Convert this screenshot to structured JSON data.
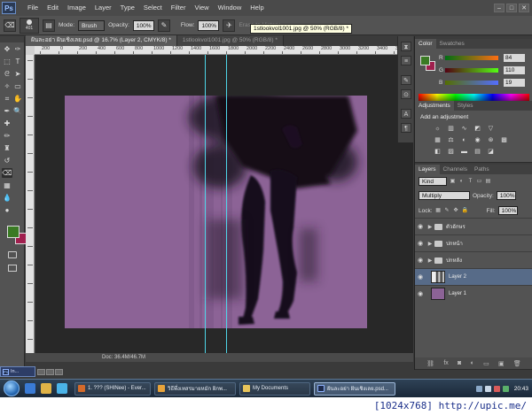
{
  "app": {
    "logo": "Ps",
    "menus": [
      "File",
      "Edit",
      "Image",
      "Layer",
      "Type",
      "Select",
      "Filter",
      "View",
      "Window",
      "Help"
    ],
    "window_controls": [
      "–",
      "□",
      "✕"
    ]
  },
  "options_bar": {
    "brush_size": "401",
    "mode_label": "Mode:",
    "mode_value": "Brush",
    "opacity_label": "Opacity:",
    "opacity_value": "100%",
    "flow_label": "Flow:",
    "flow_value": "100%",
    "erase_to_history": "Erase to History"
  },
  "tooltip": "1stlookvol1001.jpg @ 50% (RGB/8) *",
  "document_tabs": [
    {
      "label": "ฝันละอย่า ฝันเชิงเลย.psd @ 16.7% (Layer 2, CMYK/8) *",
      "active": true
    },
    {
      "label": "1stlookvol1001.jpg @ 50% (RGB/8) *",
      "active": false
    }
  ],
  "ruler": {
    "h_labels": [
      "200",
      "0",
      "200",
      "400",
      "600",
      "800",
      "1000",
      "1200",
      "1400",
      "1600",
      "1800",
      "2000",
      "2200",
      "2400",
      "2600",
      "2800",
      "3000",
      "3200",
      "3400",
      "3600"
    ]
  },
  "status_bar": "Doc: 36.4M/46.7M",
  "minimized_doc": "In...",
  "color_panel": {
    "tabs": [
      "Color",
      "Swatches"
    ],
    "fg": "#3a7a24",
    "bg": "#a01f4e",
    "channels": [
      {
        "name": "R",
        "value": "84"
      },
      {
        "name": "G",
        "value": "110"
      },
      {
        "name": "B",
        "value": "19"
      }
    ]
  },
  "adjustments_panel": {
    "tabs": [
      "Adjustments",
      "Styles"
    ],
    "title": "Add an adjustment"
  },
  "layers_panel": {
    "tabs": [
      "Layers",
      "Channels",
      "Paths"
    ],
    "filter_kind": "Kind",
    "blend_mode": "Multiply",
    "opacity_label": "Opacity:",
    "opacity_value": "100%",
    "lock_label": "Lock:",
    "fill_label": "Fill:",
    "fill_value": "100%",
    "layers": [
      {
        "name": "ตัวอักษร",
        "type": "group",
        "selected": false
      },
      {
        "name": "ปกหน้า",
        "type": "group",
        "selected": false
      },
      {
        "name": "ปกหลัง",
        "type": "group",
        "selected": false
      },
      {
        "name": "Layer 2",
        "type": "image",
        "selected": true
      },
      {
        "name": "Layer 1",
        "type": "fill",
        "selected": false
      }
    ]
  },
  "canvas": {
    "background": "#8c6396"
  },
  "taskbar": {
    "tasks": [
      {
        "label": "1. ??? (SHINee) - Ever...",
        "active": false
      },
      {
        "label": "วิธีพึ่งเทสรมายหมัก ผิกพ...",
        "active": false
      },
      {
        "label": "My Documents",
        "active": false
      },
      {
        "label": "ฝันละอย่า ฝันเชิงเลย.psd...",
        "active": true
      }
    ],
    "clock": "20:43"
  },
  "watermark": "[1024x768] http://upic.me/"
}
